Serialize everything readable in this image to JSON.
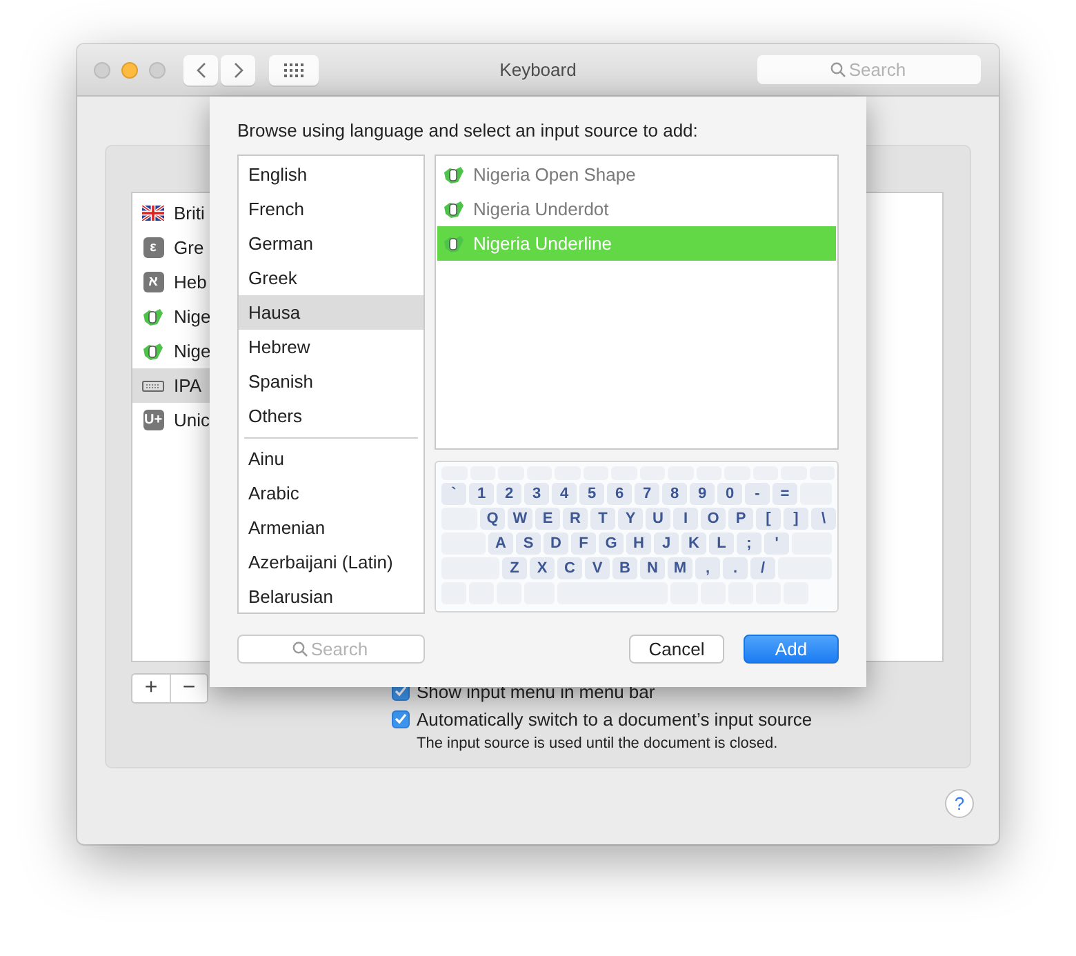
{
  "window": {
    "title": "Keyboard",
    "search": {
      "placeholder": "Search"
    }
  },
  "input_sources": [
    {
      "kind": "flag",
      "label": "Briti",
      "selected": false
    },
    {
      "kind": "glyph",
      "glyph": "ε",
      "label": "Gre",
      "selected": false
    },
    {
      "kind": "glyph",
      "glyph": "א",
      "label": "Heb",
      "selected": false
    },
    {
      "kind": "nigeria",
      "label": "Nige",
      "selected": false
    },
    {
      "kind": "nigeria",
      "label": "Nige",
      "selected": false
    },
    {
      "kind": "keyboard",
      "label": "IPA",
      "selected": true
    },
    {
      "kind": "glyph",
      "glyph": "U+",
      "label": "Unic",
      "selected": false
    }
  ],
  "add_remove": [
    "+",
    "−"
  ],
  "options": [
    {
      "label": "Show input menu in menu bar",
      "checked": true
    },
    {
      "label": "Automatically switch to a document’s input source",
      "checked": true
    }
  ],
  "note": "The input source is used until the document is closed.",
  "help": "?",
  "sheet": {
    "title": "Browse using language and select an input source to add:",
    "languages": [
      [
        {
          "label": "English",
          "selected": false
        },
        {
          "label": "French",
          "selected": false
        },
        {
          "label": "German",
          "selected": false
        },
        {
          "label": "Greek",
          "selected": false
        },
        {
          "label": "Hausa",
          "selected": true
        },
        {
          "label": "Hebrew",
          "selected": false
        },
        {
          "label": "Spanish",
          "selected": false
        },
        {
          "label": "Others",
          "selected": false
        }
      ],
      [
        {
          "label": "Ainu",
          "selected": false
        },
        {
          "label": "Arabic",
          "selected": false
        },
        {
          "label": "Armenian",
          "selected": false
        },
        {
          "label": "Azerbaijani (Latin)",
          "selected": false
        },
        {
          "label": "Belarusian",
          "selected": false
        }
      ]
    ],
    "sources": [
      {
        "label": "Nigeria Open Shape",
        "disabled": true,
        "selected": false
      },
      {
        "label": "Nigeria Underdot",
        "disabled": true,
        "selected": false
      },
      {
        "label": "Nigeria Underline",
        "disabled": false,
        "selected": true
      }
    ],
    "keyboard": [
      [
        "`",
        "1",
        "2",
        "3",
        "4",
        "5",
        "6",
        "7",
        "8",
        "9",
        "0",
        "-",
        "="
      ],
      [
        "Q",
        "W",
        "E",
        "R",
        "T",
        "Y",
        "U",
        "I",
        "O",
        "P",
        "[",
        "]",
        "\\"
      ],
      [
        "A",
        "S",
        "D",
        "F",
        "G",
        "H",
        "J",
        "K",
        "L",
        ";",
        "'"
      ],
      [
        "Z",
        "X",
        "C",
        "V",
        "B",
        "N",
        "M",
        ",",
        ".",
        "/"
      ]
    ],
    "search": {
      "placeholder": "Search"
    },
    "buttons": [
      {
        "label": "Cancel",
        "kind": "secondary"
      },
      {
        "label": "Add",
        "kind": "default"
      }
    ]
  }
}
